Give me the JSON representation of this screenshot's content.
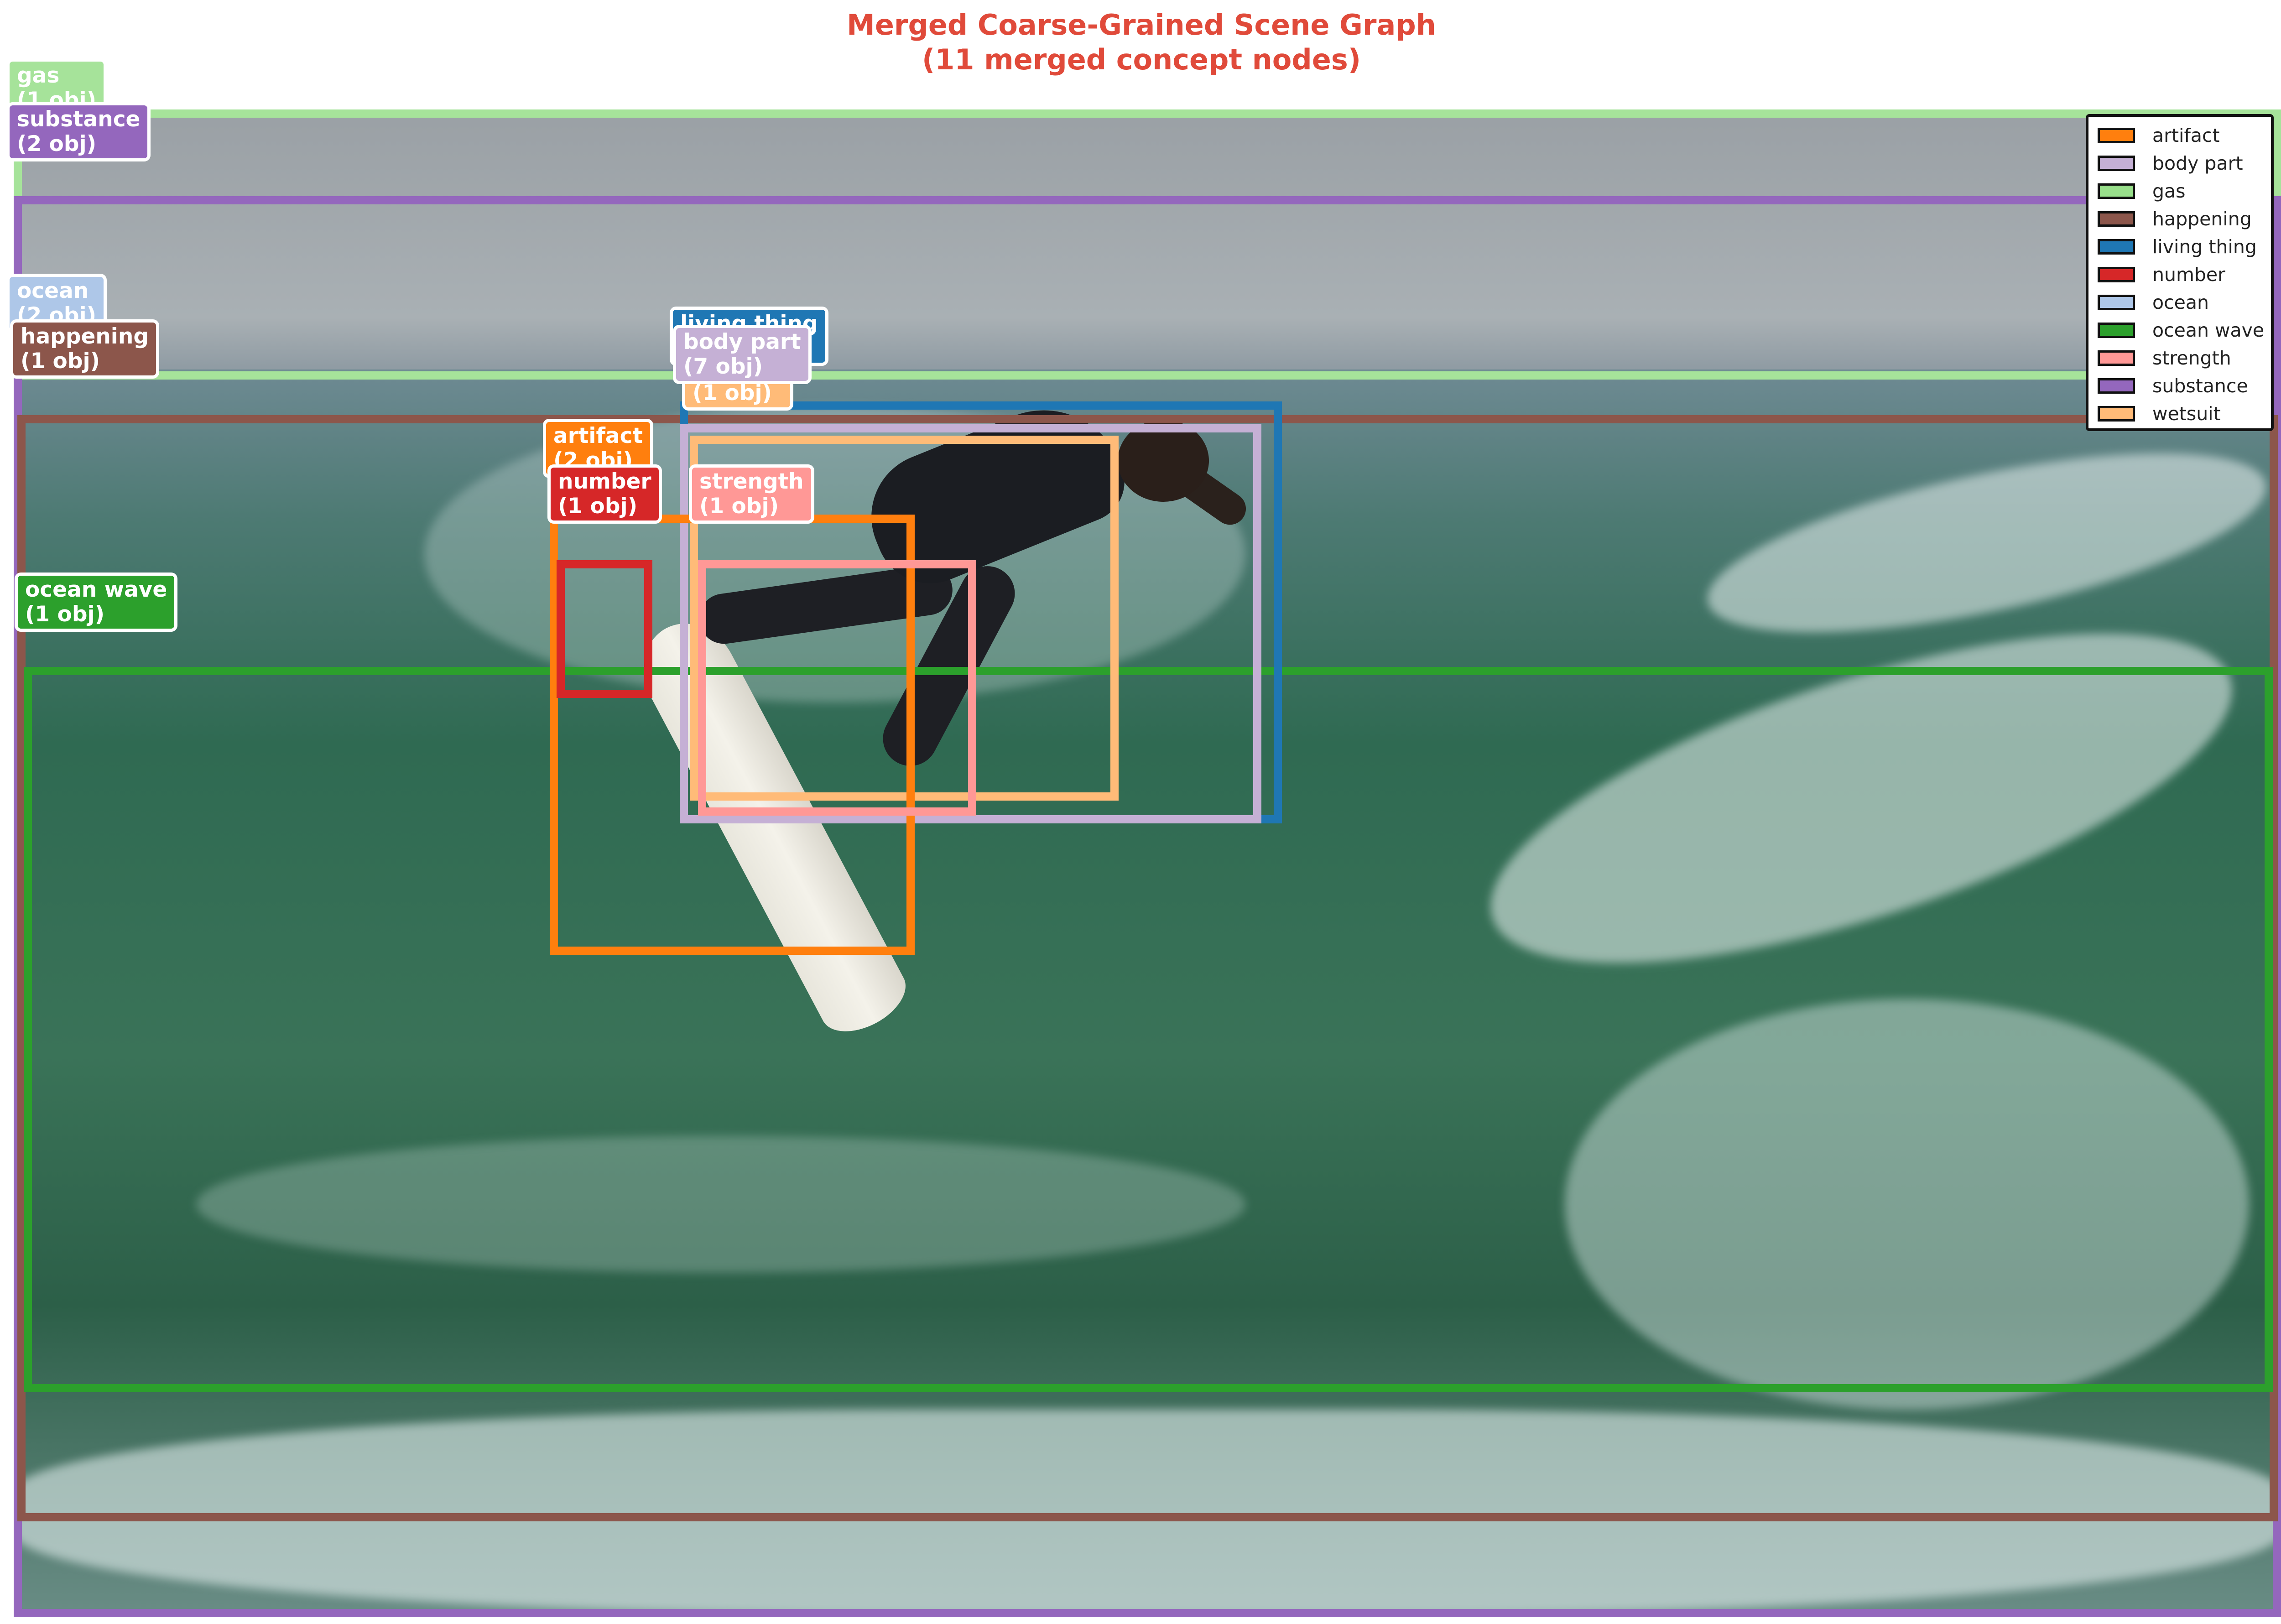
{
  "title_line1": "Merged Coarse-Grained Scene Graph",
  "title_line2": "(11 merged concept nodes)",
  "boxes": [
    {
      "name": "gas",
      "color": "#a6e39a",
      "label": "gas\n(1 obj)"
    },
    {
      "name": "substance",
      "color": "#9467bd",
      "label": "substance\n(2 obj)"
    },
    {
      "name": "ocean",
      "color": "#aec7e8",
      "label": "ocean\n(2 obj)"
    },
    {
      "name": "happening",
      "color": "#8c564b",
      "label": "happening\n(1 obj)"
    },
    {
      "name": "living-thing",
      "color": "#1f77b4",
      "label": "living thing\n(1 obj)"
    },
    {
      "name": "wetsuit",
      "color": "#ffbb78",
      "label": "wetsuit\n(1 obj)"
    },
    {
      "name": "body-part",
      "color": "#c5b0d5",
      "label": "body part\n(7 obj)"
    },
    {
      "name": "artifact",
      "color": "#ff7f0e",
      "label": "artifact\n(2 obj)"
    },
    {
      "name": "number",
      "color": "#d62728",
      "label": "number\n(1 obj)"
    },
    {
      "name": "strength",
      "color": "#ff9896",
      "label": "strength\n(1 obj)"
    },
    {
      "name": "ocean-wave",
      "color": "#2ca02c",
      "label": "ocean wave\n(1 obj)"
    }
  ],
  "legend": [
    {
      "label": "artifact",
      "color": "#ff7f0e"
    },
    {
      "label": "body part",
      "color": "#c5b0d5"
    },
    {
      "label": "gas",
      "color": "#98df8a"
    },
    {
      "label": "happening",
      "color": "#8c564b"
    },
    {
      "label": "living thing",
      "color": "#1f77b4"
    },
    {
      "label": "number",
      "color": "#d62728"
    },
    {
      "label": "ocean",
      "color": "#aec7e8"
    },
    {
      "label": "ocean wave",
      "color": "#2ca02c"
    },
    {
      "label": "strength",
      "color": "#ff9896"
    },
    {
      "label": "substance",
      "color": "#9467bd"
    },
    {
      "label": "wetsuit",
      "color": "#ffbb78"
    }
  ]
}
